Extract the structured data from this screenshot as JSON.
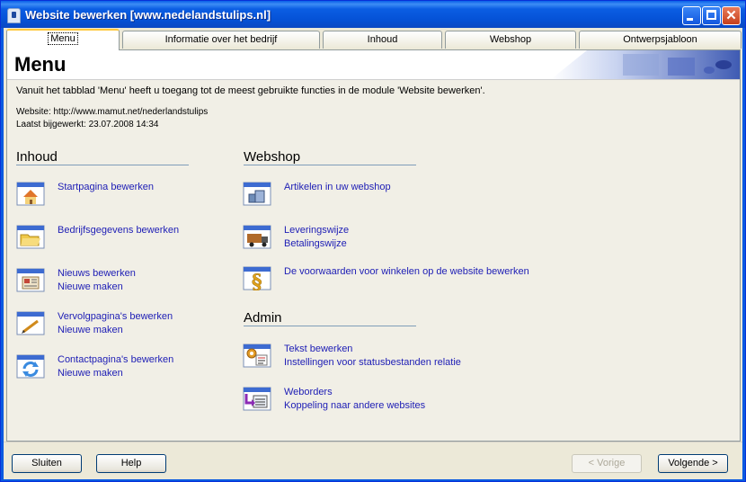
{
  "window": {
    "title": "Website bewerken [www.nedelandstulips.nl]"
  },
  "tabs": [
    {
      "label": "Menu"
    },
    {
      "label": "Informatie over het bedrijf"
    },
    {
      "label": "Inhoud"
    },
    {
      "label": "Webshop"
    },
    {
      "label": "Ontwerpsjabloon"
    }
  ],
  "header": {
    "title": "Menu"
  },
  "intro": "Vanuit het tabblad 'Menu' heeft u toegang tot de meest gebruikte functies in de module 'Website bewerken'.",
  "info": {
    "website": "Website: http://www.mamut.net/nederlandstulips",
    "updated": "Laatst bijgewerkt: 23.07.2008 14:34"
  },
  "inhoud": {
    "heading": "Inhoud",
    "items": [
      {
        "icon": "house-icon",
        "links": [
          "Startpagina bewerken"
        ]
      },
      {
        "icon": "folder-icon",
        "links": [
          "Bedrijfsgegevens bewerken"
        ]
      },
      {
        "icon": "newspaper-icon",
        "links": [
          "Nieuws bewerken",
          "Nieuwe maken"
        ]
      },
      {
        "icon": "page-pencil-icon",
        "links": [
          "Vervolgpagina's bewerken",
          "Nieuwe maken"
        ]
      },
      {
        "icon": "contact-refresh-icon",
        "links": [
          "Contactpagina's bewerken",
          "Nieuwe maken"
        ]
      }
    ]
  },
  "webshop": {
    "heading": "Webshop",
    "items": [
      {
        "icon": "products-icon",
        "links": [
          "Artikelen in uw webshop"
        ]
      },
      {
        "icon": "delivery-truck-icon",
        "links": [
          "Leveringswijze",
          "Betalingswijze"
        ]
      },
      {
        "icon": "paragraph-icon",
        "links": [
          "De voorwaarden voor winkelen op de website bewerken"
        ]
      }
    ]
  },
  "admin": {
    "heading": "Admin",
    "items": [
      {
        "icon": "text-settings-icon",
        "links": [
          "Tekst bewerken",
          "Instellingen voor statusbestanden relatie"
        ]
      },
      {
        "icon": "weborders-icon",
        "links": [
          "Weborders",
          "Koppeling naar andere websites"
        ]
      }
    ]
  },
  "buttons": {
    "close": "Sluiten",
    "help": "Help",
    "previous": "< Vorige",
    "next": "Volgende >"
  },
  "colors": {
    "link": "#1d1db5",
    "titlebar": "#0552d6",
    "active_tab_accent": "#ffc83c"
  }
}
